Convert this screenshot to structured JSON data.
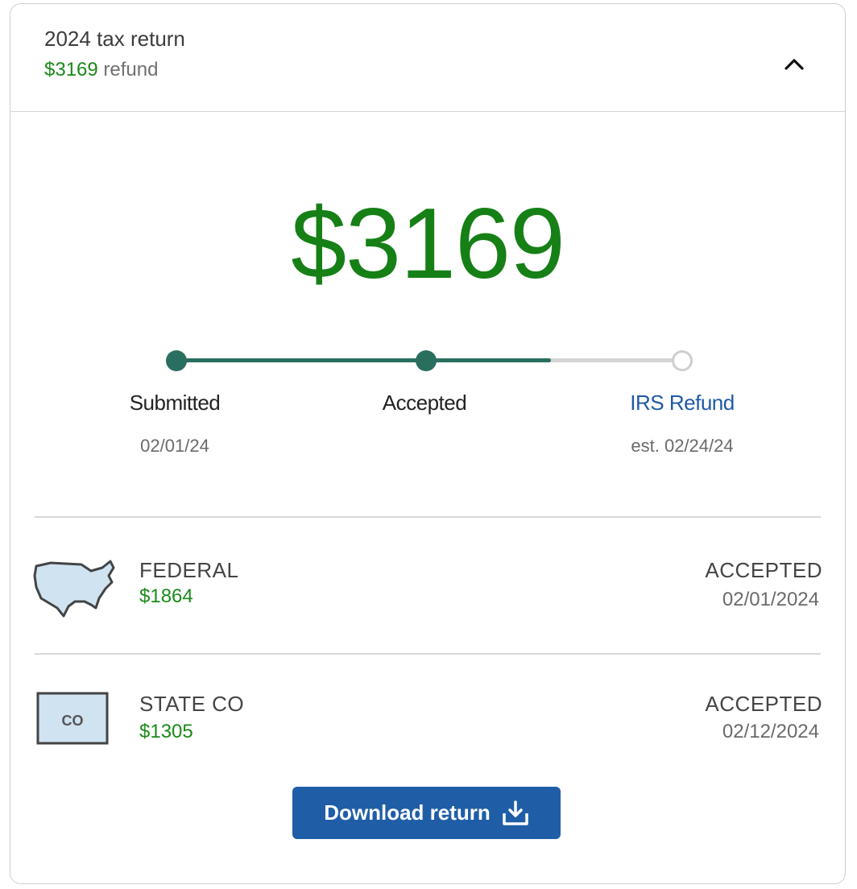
{
  "header": {
    "title": "2024 tax return",
    "refund_amount": "$3169",
    "refund_suffix": " refund"
  },
  "summary": {
    "total_refund": "$3169"
  },
  "progress": {
    "filled_fraction": 0.74,
    "steps": [
      {
        "label": "Submitted",
        "date": "02/01/24",
        "state": "complete"
      },
      {
        "label": "Accepted",
        "date": "",
        "state": "complete"
      },
      {
        "label": "IRS Refund",
        "date": "est. 02/24/24",
        "state": "pending"
      }
    ]
  },
  "returns": [
    {
      "name": "FEDERAL",
      "amount": "$1864",
      "status": "ACCEPTED",
      "date": "02/01/2024",
      "icon": "usa-map-icon"
    },
    {
      "name": "STATE CO",
      "amount": "$1305",
      "status": "ACCEPTED",
      "date": "02/12/2024",
      "icon": "colorado-map-icon",
      "icon_text": "CO"
    }
  ],
  "actions": {
    "download_label": "Download return"
  },
  "colors": {
    "refund_green": "#168016",
    "progress_teal": "#2a6e60",
    "link_blue": "#1f5aa6",
    "button_blue": "#1f5ea7"
  }
}
